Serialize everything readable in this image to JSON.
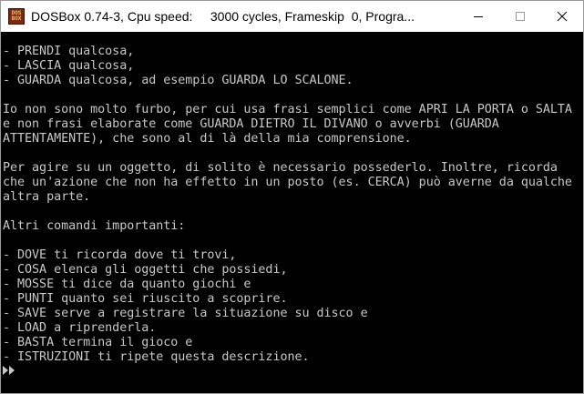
{
  "window": {
    "title": "DOSBox 0.74-3, Cpu speed:     3000 cycles, Frameskip  0, Progra...",
    "icon_text_top": "DOS",
    "icon_text_bottom": "BOX",
    "icon": "dosbox-icon"
  },
  "controls": {
    "minimize_icon": "minimize-icon",
    "maximize_icon": "maximize-icon",
    "close_icon": "close-icon"
  },
  "console": {
    "text_color": "#c8c8c8",
    "background": "#000000",
    "lines": [
      "- PRENDI qualcosa,",
      "- LASCIA qualcosa,",
      "- GUARDA qualcosa, ad esempio GUARDA LO SCALONE.",
      "",
      "Io non sono molto furbo, per cui usa frasi semplici come APRI LA PORTA o SALTA",
      "e non frasi elaborate come GUARDA DIETRO IL DIVANO o avverbi (GUARDA",
      "ATTENTAMENTE), che sono al di là della mia comprensione.",
      "",
      "Per agire su un oggetto, di solito è necessario possederlo. Inoltre, ricorda",
      "che un'azione che non ha effetto in un posto (es. CERCA) può averne da qualche",
      "altra parte.",
      "",
      "Altri comandi importanti:",
      "",
      "- DOVE ti ricorda dove ti trovi,",
      "- COSA elenca gli oggetti che possiedi,",
      "- MOSSE ti dice da quanto giochi e",
      "- PUNTI quanto sei riuscito a scoprire.",
      "- SAVE serve a registrare la situazione su disco e",
      "- LOAD a riprenderla.",
      "- BASTA termina il gioco e",
      "- ISTRUZIONI ti ripete questa descrizione."
    ],
    "prompt_icon": "double-arrow-prompt-icon"
  }
}
